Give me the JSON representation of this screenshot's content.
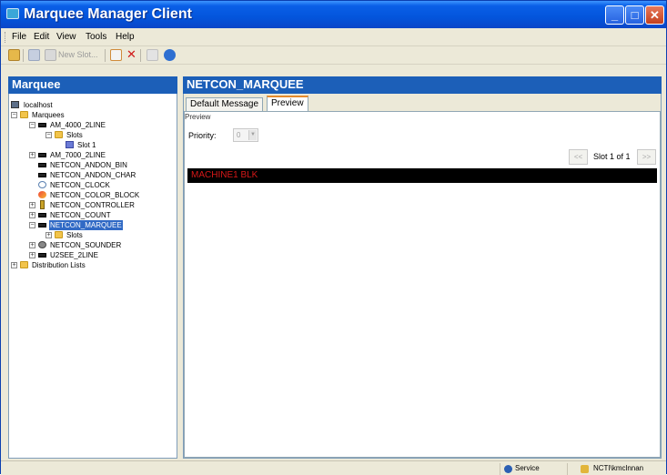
{
  "window": {
    "title": "Marquee Manager Client"
  },
  "menu": {
    "items": [
      "File",
      "Edit",
      "View",
      "Tools",
      "Help"
    ]
  },
  "toolbar": {
    "new_slot_label": "New Slot..."
  },
  "left_panel": {
    "title": "Marquee",
    "tree": {
      "host": "localhost",
      "marquees_label": "Marquees",
      "am_4000": "AM_4000_2LINE",
      "slots": "Slots",
      "slot1": "Slot 1",
      "am_7000": "AM_7000_2LINE",
      "andon_bin": "NETCON_ANDON_BIN",
      "andon_char": "NETCON_ANDON_CHAR",
      "clock": "NETCON_CLOCK",
      "color_block": "NETCON_COLOR_BLOCK",
      "controller": "NETCON_CONTROLLER",
      "count": "NETCON_COUNT",
      "marquee": "NETCON_MARQUEE",
      "marquee_slots": "Slots",
      "sounder": "NETCON_SOUNDER",
      "u2see": "U2SEE_2LINE",
      "distribution": "Distribution Lists"
    }
  },
  "right_panel": {
    "title": "NETCON_MARQUEE",
    "tabs": [
      "Default Message",
      "Preview"
    ],
    "active_tab": "Preview",
    "group_label": "Preview",
    "priority_label": "Priority:",
    "priority_value": "0",
    "slot_text": "Slot 1 of 1",
    "prev_btn": "<<",
    "next_btn": ">>",
    "preview_message": "MACHINE1 BLK"
  },
  "status": {
    "service": "Service",
    "user": "NCTI\\kmclnnan"
  },
  "colors": {
    "titlebar": "#0355DC",
    "panel_header": "#1C5FB8",
    "selection": "#316AC5",
    "preview_text": "#d81818"
  }
}
